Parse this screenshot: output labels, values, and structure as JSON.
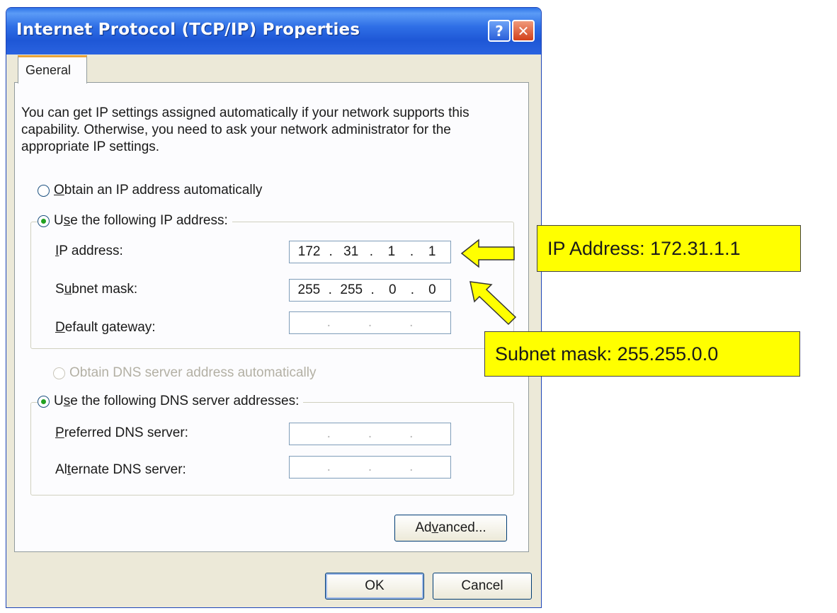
{
  "window": {
    "title": "Internet Protocol (TCP/IP) Properties",
    "help_glyph": "?",
    "close_glyph": "✕"
  },
  "tabs": [
    {
      "label": "General",
      "active": true
    }
  ],
  "description": "You can get IP settings assigned automatically if your network supports this capability. Otherwise, you need to ask your network administrator for the appropriate IP settings.",
  "ip_mode": {
    "auto": {
      "first": "O",
      "rest": "btain an IP address automatically",
      "checked": false
    },
    "manual": {
      "pre": "U",
      "key": "s",
      "rest": "e the following IP address:",
      "checked": true
    }
  },
  "ip_fields": {
    "ip_address": {
      "pre": "",
      "key": "I",
      "rest": "P address:",
      "octets": [
        "172",
        "31",
        "1",
        "1"
      ]
    },
    "subnet_mask": {
      "pre": "S",
      "key": "u",
      "rest": "bnet mask:",
      "octets": [
        "255",
        "255",
        "0",
        "0"
      ]
    },
    "default_gateway": {
      "pre": "",
      "key": "D",
      "rest": "efault gateway:",
      "octets": [
        "",
        "",
        "",
        ""
      ]
    }
  },
  "dns_mode": {
    "auto": {
      "label": "Obtain DNS server address automatically",
      "enabled": false
    },
    "manual": {
      "pre": "U",
      "key": "s",
      "rest": "e the following DNS server addresses:",
      "checked": true
    }
  },
  "dns_fields": {
    "preferred": {
      "pre": "",
      "key": "P",
      "rest": "referred DNS server:",
      "octets": [
        "",
        "",
        "",
        ""
      ]
    },
    "alternate": {
      "pre": "Al",
      "key": "t",
      "rest": "ernate DNS server:",
      "octets": [
        "",
        "",
        "",
        ""
      ]
    }
  },
  "buttons": {
    "advanced": {
      "pre": "Ad",
      "key": "v",
      "rest": "anced..."
    },
    "ok": "OK",
    "cancel": "Cancel"
  },
  "annotations": {
    "ip_callout": "IP Address: 172.31.1.1",
    "mask_callout": "Subnet mask: 255.255.0.0",
    "color": "#ffff00"
  },
  "colors": {
    "titlebar": "#1e57d6",
    "dialog_bg": "#ece9d8",
    "radio_checked": "#21a121",
    "close_button": "#d2401a"
  }
}
